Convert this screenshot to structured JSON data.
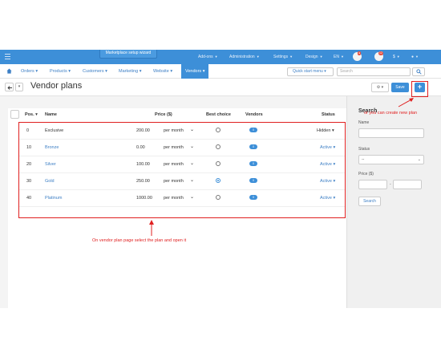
{
  "topbar": {
    "wizard_label": "Marketplace setup wizard",
    "items": [
      "Add-ons",
      "Administration",
      "Settings",
      "Design",
      "EN",
      "$"
    ],
    "notification_count": "12"
  },
  "nav": {
    "items": [
      "Orders",
      "Products",
      "Customers",
      "Marketing",
      "Website"
    ],
    "active": "Vendors",
    "quick_start": "Quick start menu",
    "search_placeholder": "Search"
  },
  "page": {
    "title": "Vendor plans",
    "save_label": "Save",
    "add_label": "+"
  },
  "table": {
    "headers": {
      "pos": "Pos.",
      "name": "Name",
      "price": "Price ($)",
      "best_choice": "Best choice",
      "vendors": "Vendors",
      "status": "Status"
    },
    "rows": [
      {
        "pos": "0",
        "name": "Exclusive",
        "price": "200.00",
        "period": "per month",
        "best_choice": false,
        "vendors": "0",
        "status": "Hidden"
      },
      {
        "pos": "10",
        "name": "Bronze",
        "price": "0.00",
        "period": "per month",
        "best_choice": false,
        "vendors": "0",
        "status": "Active"
      },
      {
        "pos": "20",
        "name": "Silver",
        "price": "100.00",
        "period": "per month",
        "best_choice": false,
        "vendors": "0",
        "status": "Active"
      },
      {
        "pos": "30",
        "name": "Gold",
        "price": "250.00",
        "period": "per month",
        "best_choice": true,
        "vendors": "0",
        "status": "Active"
      },
      {
        "pos": "40",
        "name": "Platinum",
        "price": "1000.00",
        "period": "per month",
        "best_choice": false,
        "vendors": "0",
        "status": "Active"
      }
    ]
  },
  "sidebar": {
    "title": "Search",
    "name_label": "Name",
    "status_label": "Status",
    "status_value": "--",
    "price_label": "Price ($)",
    "range_separator": "-",
    "search_button": "Search"
  },
  "annotations": {
    "create_note": "or you can create new plan",
    "open_note": "On vendor plan page select the plan and open it"
  },
  "colors": {
    "accent": "#3d8fd8",
    "annotation": "#e02020"
  }
}
